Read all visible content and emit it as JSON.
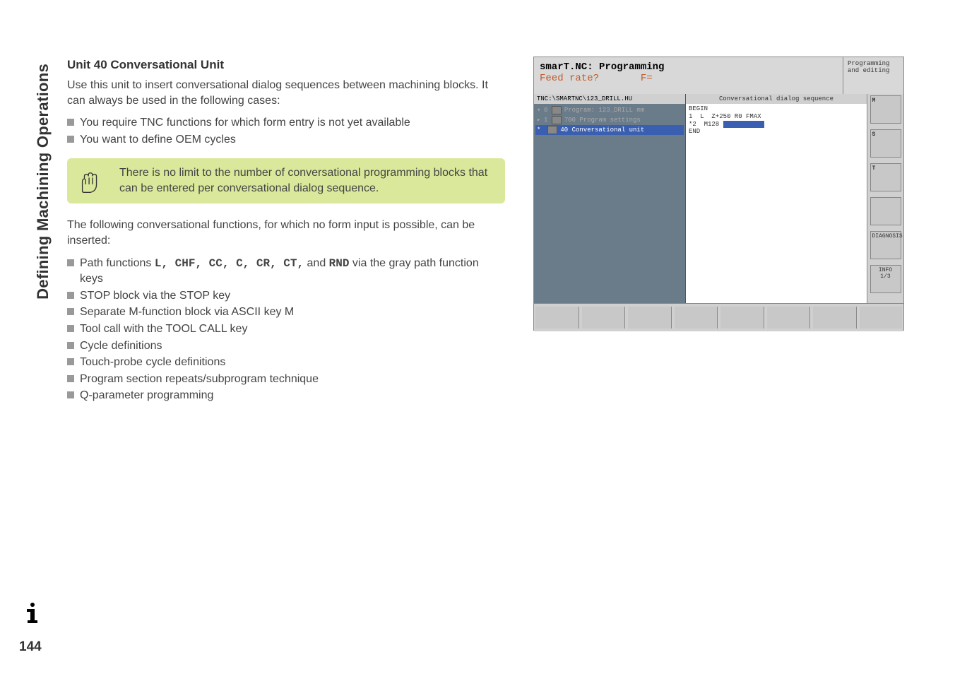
{
  "sidebar_title": "Defining Machining Operations",
  "page_number": "144",
  "heading": "Unit 40 Conversational Unit",
  "intro": "Use this unit to insert conversational dialog sequences between machining blocks. It can always be used in the following cases:",
  "bullets_a": [
    "You require TNC functions for which form entry is not yet available",
    "You want to define OEM cycles"
  ],
  "note": "There is no limit to the number of conversational programming blocks that can be entered per conversational dialog sequence.",
  "para2": "The following conversational functions, for which no form input is possible, can be inserted:",
  "path_prefix": "Path functions ",
  "path_codes": "L, CHF, CC, C, CR, CT,",
  "path_mid": " and ",
  "path_rnd": "RND",
  "path_suffix": " via the gray path function keys",
  "bullets_b": [
    "STOP block via the STOP key",
    "Separate M-function block via ASCII key M",
    "Tool call with the TOOL CALL key",
    "Cycle definitions",
    "Touch-probe cycle definitions",
    "Program section repeats/subprogram technique",
    "Q-parameter programming"
  ],
  "screenshot": {
    "title": "smarT.NC: Programming",
    "subtitle_left": "Feed rate?",
    "subtitle_right": "F=",
    "mode": "Programming and editing",
    "left_header": "TNC:\\SMARTNC\\123_DRILL.HU",
    "right_header": "Conversational dialog sequence",
    "tree": [
      {
        "arrow": "▾",
        "idx": "0",
        "label": "Program: 123_DRILL mm",
        "active": false
      },
      {
        "arrow": "▸",
        "idx": "1",
        "label": "700 Program settings",
        "active": false
      },
      {
        "arrow": "*",
        "idx": "",
        "label": "40 Conversational unit",
        "active": true
      }
    ],
    "code": [
      "BEGIN",
      "1  L  Z+250 R0 FMAX",
      "*2  M128 ",
      "END"
    ],
    "side_labels": [
      "M",
      "S",
      "T",
      "",
      "DIAGNOSIS",
      "INFO 1/3"
    ]
  }
}
